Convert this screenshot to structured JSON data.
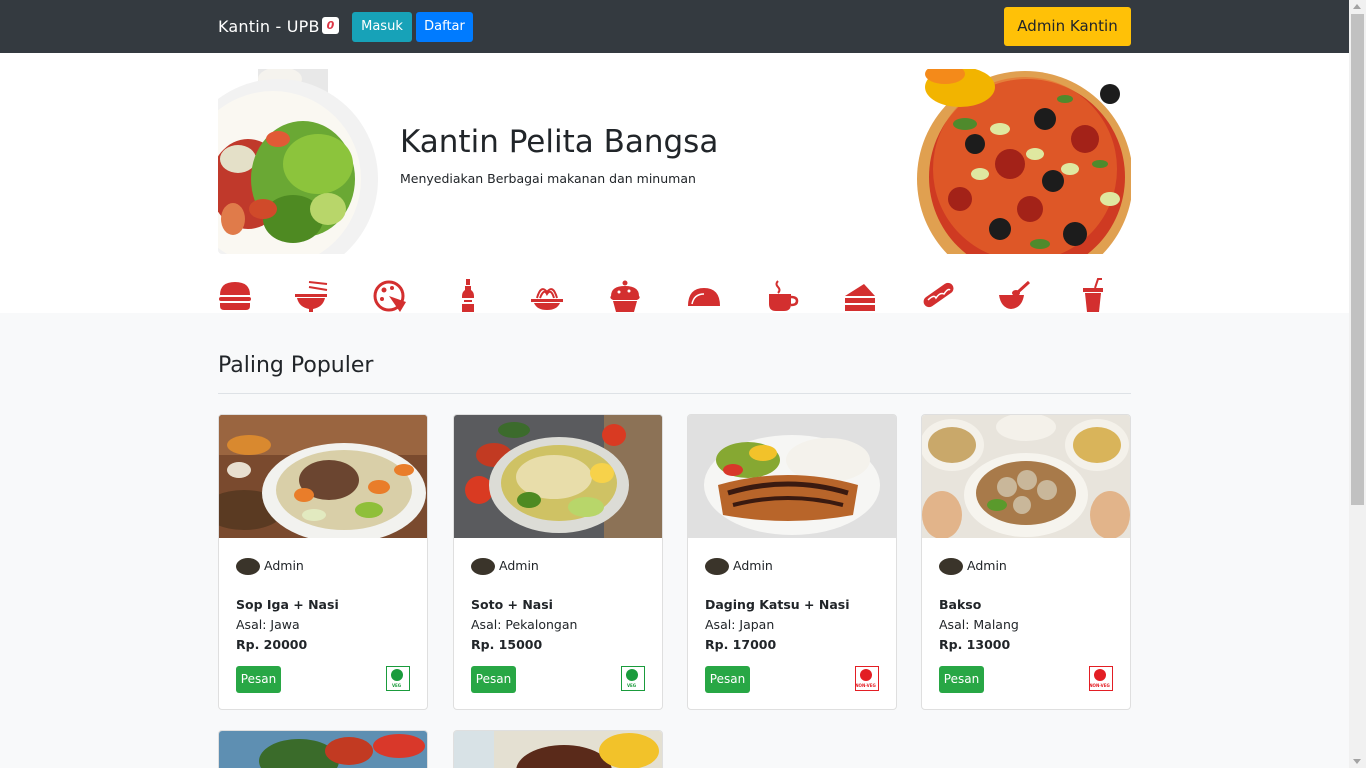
{
  "navbar": {
    "brand": "Kantin - UPB",
    "cart_count": "0",
    "login_label": "Masuk",
    "register_label": "Daftar",
    "admin_label": "Admin Kantin"
  },
  "hero": {
    "title": "Kantin Pelita Bangsa",
    "subtitle": "Menyediakan Berbagai makanan dan minuman"
  },
  "categories": [
    {
      "icon": "burger-icon"
    },
    {
      "icon": "noodle-bowl-icon"
    },
    {
      "icon": "pizza-icon"
    },
    {
      "icon": "bottle-icon"
    },
    {
      "icon": "spaghetti-icon"
    },
    {
      "icon": "cupcake-icon"
    },
    {
      "icon": "taco-icon"
    },
    {
      "icon": "coffee-cup-icon"
    },
    {
      "icon": "cake-slice-icon"
    },
    {
      "icon": "hotdog-icon"
    },
    {
      "icon": "soup-bowl-icon"
    },
    {
      "icon": "soda-cup-icon"
    }
  ],
  "section": {
    "title": "Paling Populer"
  },
  "menu_items": [
    {
      "author": "Admin",
      "name": "Sop Iga + Nasi",
      "origin": "Asal: Jawa",
      "price": "Rp. 20000",
      "order_label": "Pesan",
      "diet": "veg",
      "diet_label": "VEG"
    },
    {
      "author": "Admin",
      "name": "Soto + Nasi",
      "origin": "Asal: Pekalongan",
      "price": "Rp. 15000",
      "order_label": "Pesan",
      "diet": "veg",
      "diet_label": "VEG"
    },
    {
      "author": "Admin",
      "name": "Daging Katsu + Nasi",
      "origin": "Asal: Japan",
      "price": "Rp. 17000",
      "order_label": "Pesan",
      "diet": "non-veg",
      "diet_label": "NON-VEG"
    },
    {
      "author": "Admin",
      "name": "Bakso",
      "origin": "Asal: Malang",
      "price": "Rp. 13000",
      "order_label": "Pesan",
      "diet": "non-veg",
      "diet_label": "NON-VEG"
    }
  ],
  "colors": {
    "navbar": "#343a40",
    "info": "#17a2b8",
    "primary": "#007bff",
    "warning": "#ffc107",
    "success": "#28a745",
    "icon_red": "#d32f2f",
    "veg_green": "#1a9b3c",
    "nonveg_red": "#e31e24"
  }
}
